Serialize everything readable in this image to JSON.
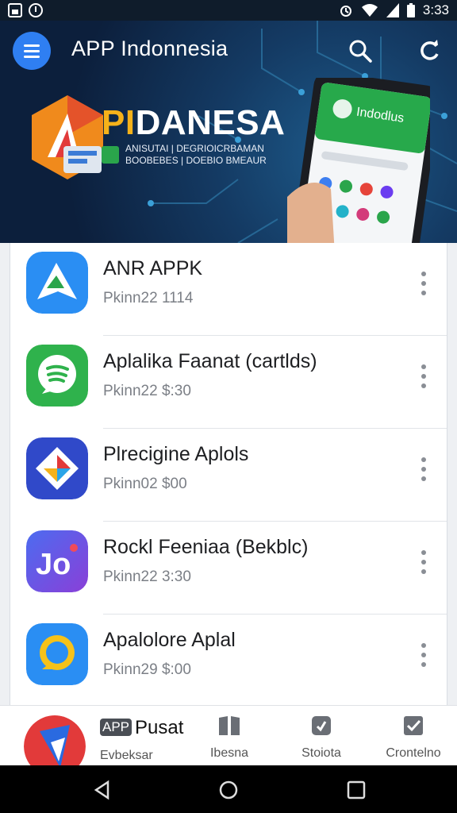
{
  "status_bar": {
    "time": "3:33"
  },
  "app_bar": {
    "title": "APP Indonnesia"
  },
  "banner": {
    "brand_accent": "PI",
    "brand_rest": "DANESA",
    "tagline_line1": "ANISUTAI | DEGRIOICRBAMAN",
    "tagline_line2": "BOOBEBES | DOEBIO BMEAUR",
    "phone_header": "Indodlus"
  },
  "apps": [
    {
      "name": "ANR APPK",
      "meta": "Pkinn22 1114"
    },
    {
      "name": "Aplalika Faanat (cartlds)",
      "meta": "Pkinn22 $:30"
    },
    {
      "name": "Plrecigine Aplols",
      "meta": "Pkinn02 $00"
    },
    {
      "name": "Rockl Feeniaa (Bekblc)",
      "meta": "Pkinn22 3:30"
    },
    {
      "name": "Apalolore Aplal",
      "meta": "Pkinn29 $:00"
    }
  ],
  "bottom_nav": {
    "app_chip": "APP",
    "pusat": "Pusat",
    "items": [
      {
        "label": "Evbeksar"
      },
      {
        "label": "Ibesna"
      },
      {
        "label": "Stoiota"
      },
      {
        "label": "Crontelno"
      }
    ]
  },
  "colors": {
    "accent": "#2f7ff2",
    "header_bg": "#0c1f3c",
    "brand_yellow": "#f6b21a"
  }
}
